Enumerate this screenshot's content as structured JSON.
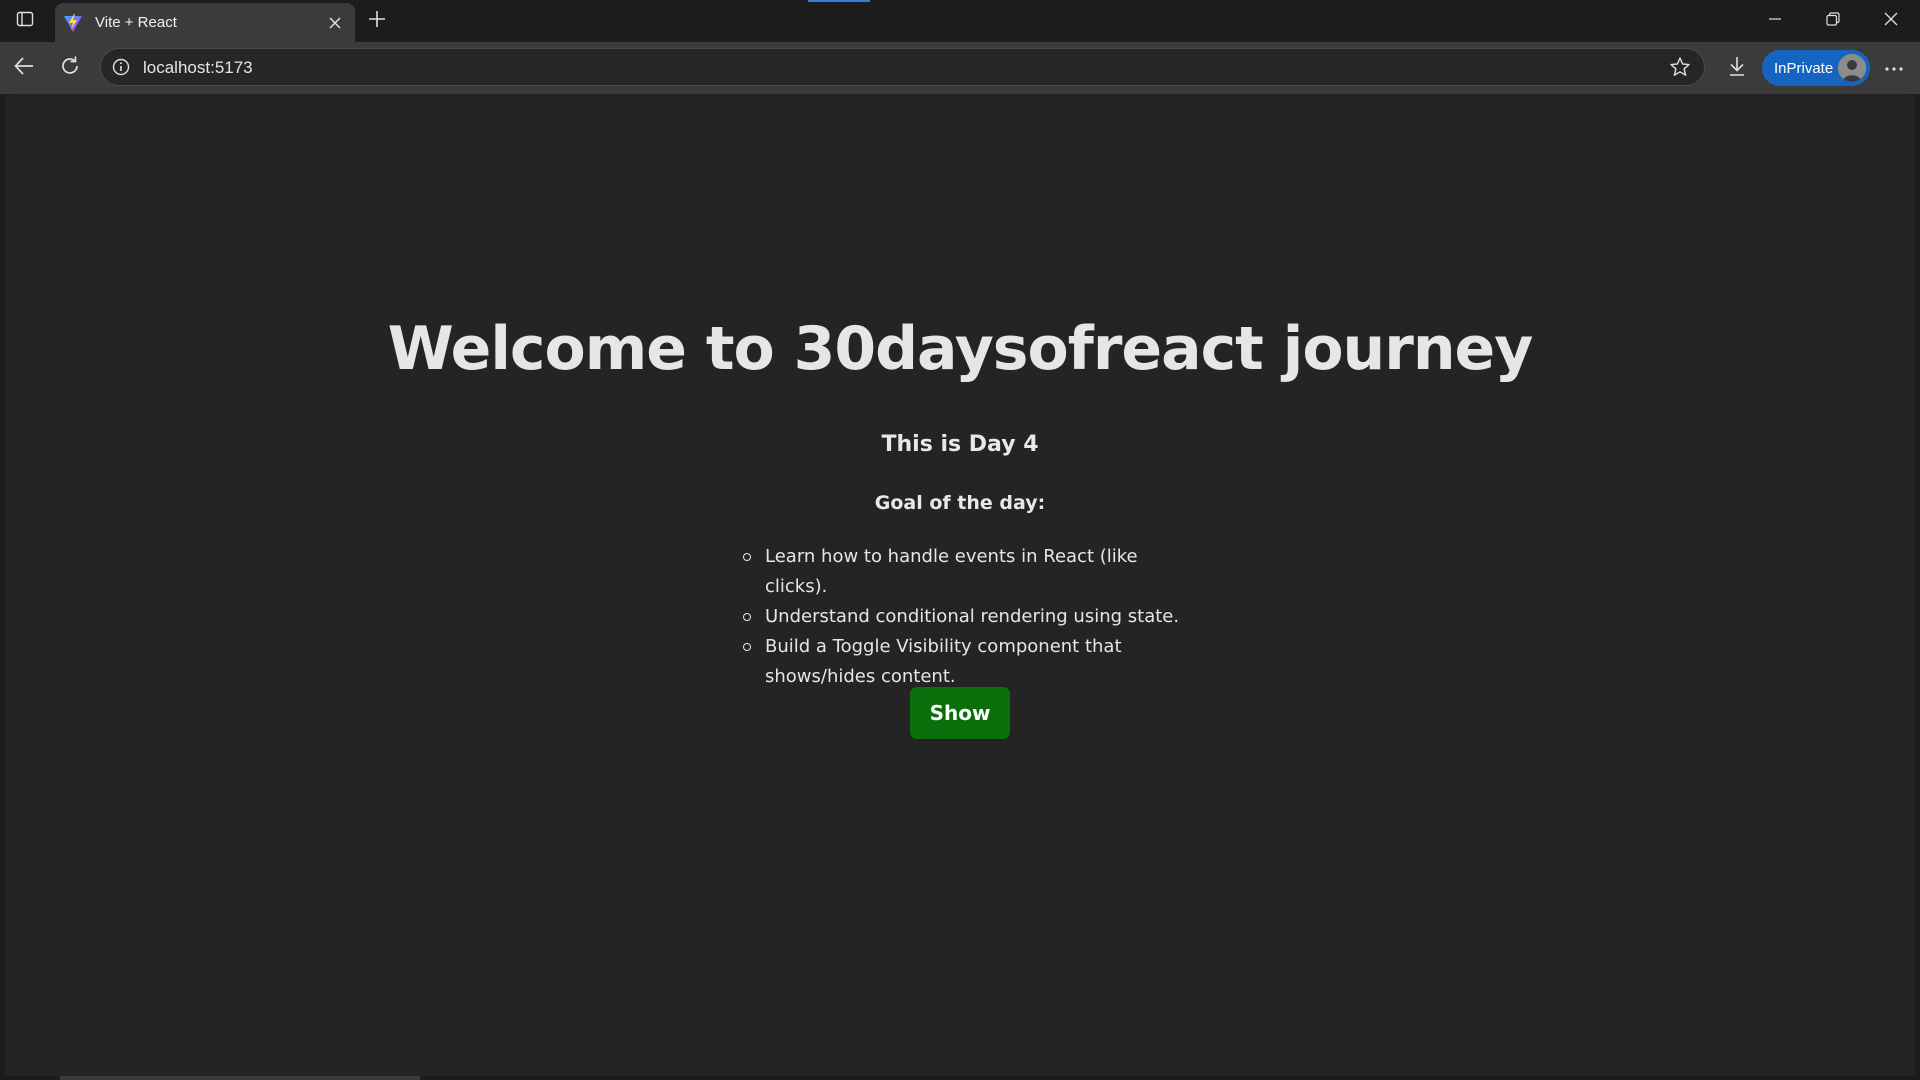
{
  "browser": {
    "tab": {
      "title": "Vite + React"
    },
    "address": {
      "url": "localhost:5173"
    },
    "profile": {
      "label": "InPrivate"
    },
    "colors": {
      "accent": "#2f7fd8",
      "inprivate": "#1565c0"
    }
  },
  "page": {
    "heading": "Welcome to 30daysofreact journey",
    "day": "This is Day 4",
    "goal_title": "Goal of the day:",
    "goals": [
      "Learn how to handle events in React (like clicks).",
      "Understand conditional rendering using state.",
      "Build a Toggle Visibility component that shows/hides content."
    ],
    "button_label": "Show",
    "button_color": "#0a6e0a"
  }
}
